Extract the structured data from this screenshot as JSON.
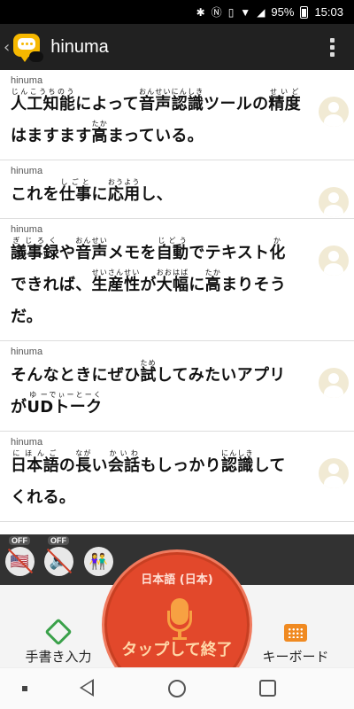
{
  "status_bar": {
    "battery": "95%",
    "time": "15:03"
  },
  "app_bar": {
    "title": "hinuma"
  },
  "messages": [
    {
      "speaker": "hinuma",
      "segments": [
        {
          "t": "人工知能",
          "r": "じんこうちのう"
        },
        {
          "t": "によって"
        },
        {
          "t": "音声認識",
          "r": "おんせいにんしき"
        },
        {
          "t": "ツールの"
        },
        {
          "t": "精度",
          "r": "せいど"
        },
        {
          "t": "はますます"
        },
        {
          "t": "高",
          "r": "たか"
        },
        {
          "t": "まっている。"
        }
      ]
    },
    {
      "speaker": "hinuma",
      "segments": [
        {
          "t": "これを"
        },
        {
          "t": "仕事",
          "r": "しごと"
        },
        {
          "t": "に"
        },
        {
          "t": "応用",
          "r": "おうよう"
        },
        {
          "t": "し、"
        }
      ]
    },
    {
      "speaker": "hinuma",
      "segments": [
        {
          "t": "議事録",
          "r": "ぎじろく"
        },
        {
          "t": "や"
        },
        {
          "t": "音声",
          "r": "おんせい"
        },
        {
          "t": "メモを"
        },
        {
          "t": "自動",
          "r": "じどう"
        },
        {
          "t": "でテキスト"
        },
        {
          "t": "化",
          "r": "か"
        },
        {
          "t": "できれば、"
        },
        {
          "t": "生産性",
          "r": "せいさんせい"
        },
        {
          "t": "が"
        },
        {
          "t": "大幅",
          "r": "おおはば"
        },
        {
          "t": "に"
        },
        {
          "t": "高",
          "r": "たか"
        },
        {
          "t": "まりそうだ。"
        }
      ]
    },
    {
      "speaker": "hinuma",
      "segments": [
        {
          "t": "そんなときにぜひ"
        },
        {
          "t": "試",
          "r": "ため"
        },
        {
          "t": "してみたいアプリが"
        },
        {
          "t": "U",
          "r": "ゆ"
        },
        {
          "t": "Dトーク",
          "r": "ーでぃーとーく"
        }
      ]
    },
    {
      "speaker": "hinuma",
      "segments": [
        {
          "t": "日本語",
          "r": "にほんご"
        },
        {
          "t": "の"
        },
        {
          "t": "長",
          "r": "なが"
        },
        {
          "t": "い"
        },
        {
          "t": "会話",
          "r": "かいわ"
        },
        {
          "t": "もしっかり"
        },
        {
          "t": "認識",
          "r": "にんしき"
        },
        {
          "t": "してくれる。"
        }
      ]
    }
  ],
  "toolbar": {
    "flag_off": "OFF",
    "sound_off": "OFF"
  },
  "mic": {
    "language": "日本語 (日本)",
    "label": "タップして終了"
  },
  "bottom": {
    "handwriting": "手書き入力",
    "keyboard": "キーボード"
  }
}
